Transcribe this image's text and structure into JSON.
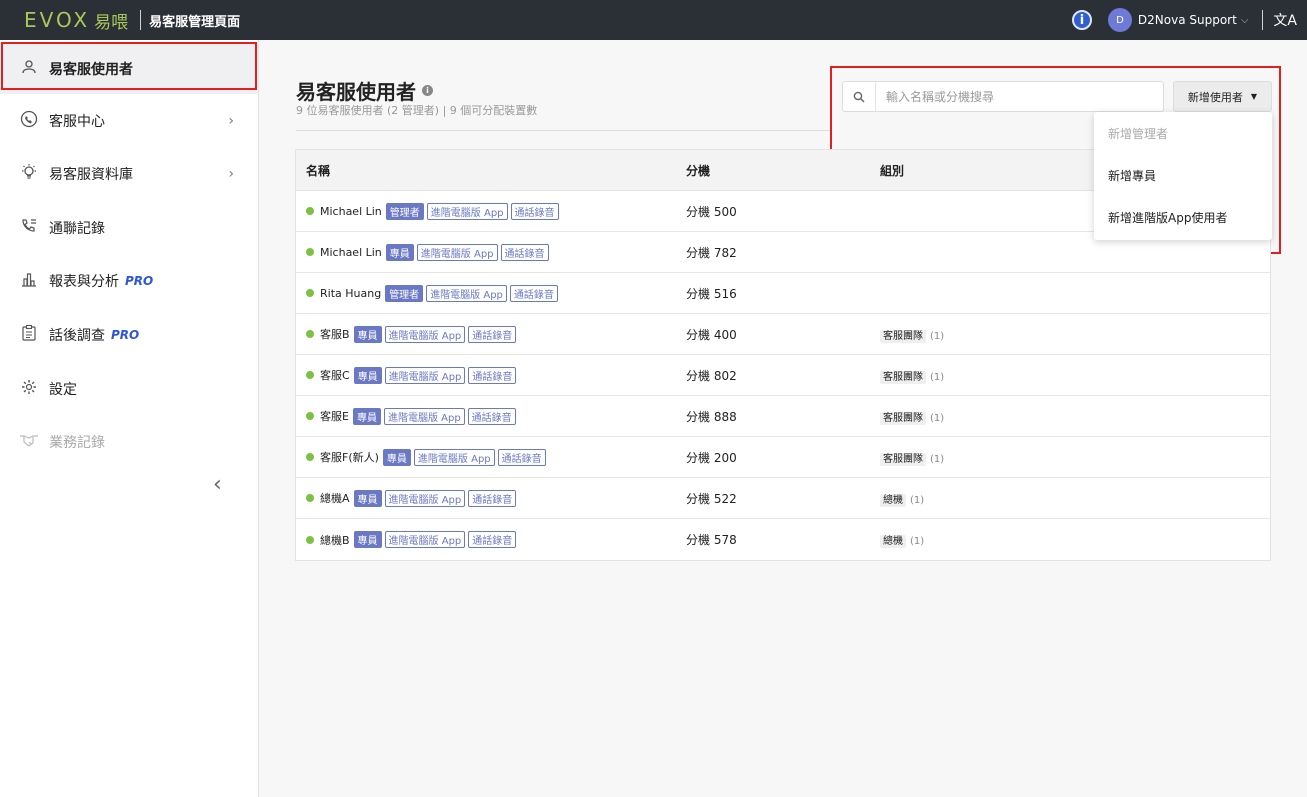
{
  "topbar": {
    "logo_mark": "EVOX",
    "logo_cn": "易喂",
    "app_title": "易客服管理頁面",
    "info": "i",
    "avatar_initial": "D",
    "user_name": "D2Nova Support",
    "lang_icon": "文A"
  },
  "sidebar": {
    "items": [
      {
        "label": "易客服使用者",
        "icon": "user-icon"
      },
      {
        "label": "客服中心",
        "icon": "call-center-icon"
      },
      {
        "label": "易客服資料庫",
        "icon": "lightbulb-icon"
      },
      {
        "label": "通聯記錄",
        "icon": "call-log-icon"
      },
      {
        "label": "報表與分析",
        "pro": "PRO",
        "icon": "chart-icon"
      },
      {
        "label": "話後調查",
        "pro": "PRO",
        "icon": "survey-icon"
      },
      {
        "label": "設定",
        "icon": "gear-icon"
      },
      {
        "label": "業務記錄",
        "icon": "handshake-icon"
      }
    ]
  },
  "main": {
    "title": "易客服使用者",
    "subtitle": "9 位易客服使用者 (2 管理者) | 9 個可分配裝置數",
    "search_placeholder": "輸入名稱或分機搜尋",
    "add_button": "新增使用者",
    "dropdown": [
      "新增管理者",
      "新增專員",
      "新增進階版App使用者"
    ],
    "columns": [
      "名稱",
      "分機",
      "組別"
    ],
    "rows": [
      {
        "name": "Michael Lin",
        "role": "管理者",
        "tags": [
          "進階電腦版 App",
          "通話錄音"
        ],
        "ext": "分機 500",
        "group": "",
        "count": ""
      },
      {
        "name": "Michael Lin",
        "role": "專員",
        "tags": [
          "進階電腦版 App",
          "通話錄音"
        ],
        "ext": "分機 782",
        "group": "",
        "count": ""
      },
      {
        "name": "Rita Huang",
        "role": "管理者",
        "tags": [
          "進階電腦版 App",
          "通話錄音"
        ],
        "ext": "分機 516",
        "group": "",
        "count": ""
      },
      {
        "name": "客服B",
        "role": "專員",
        "tags": [
          "進階電腦版 App",
          "通話錄音"
        ],
        "ext": "分機 400",
        "group": "客服團隊",
        "count": "(1)"
      },
      {
        "name": "客服C",
        "role": "專員",
        "tags": [
          "進階電腦版 App",
          "通話錄音"
        ],
        "ext": "分機 802",
        "group": "客服團隊",
        "count": "(1)"
      },
      {
        "name": "客服E",
        "role": "專員",
        "tags": [
          "進階電腦版 App",
          "通話錄音"
        ],
        "ext": "分機 888",
        "group": "客服團隊",
        "count": "(1)"
      },
      {
        "name": "客服F(新人)",
        "role": "專員",
        "tags": [
          "進階電腦版 App",
          "通話錄音"
        ],
        "ext": "分機 200",
        "group": "客服團隊",
        "count": "(1)"
      },
      {
        "name": "總機A",
        "role": "專員",
        "tags": [
          "進階電腦版 App",
          "通話錄音"
        ],
        "ext": "分機 522",
        "group": "總機",
        "count": "(1)"
      },
      {
        "name": "總機B",
        "role": "專員",
        "tags": [
          "進階電腦版 App",
          "通話錄音"
        ],
        "ext": "分機 578",
        "group": "總機",
        "count": "(1)"
      }
    ]
  },
  "colors": {
    "topbar_bg": "#2b2f36",
    "logo_green": "#a8c95a",
    "accent_blue": "#2f56d6",
    "badge_purple": "#6b78c4",
    "status_green": "#7bc142",
    "highlight_red": "#e02020"
  }
}
